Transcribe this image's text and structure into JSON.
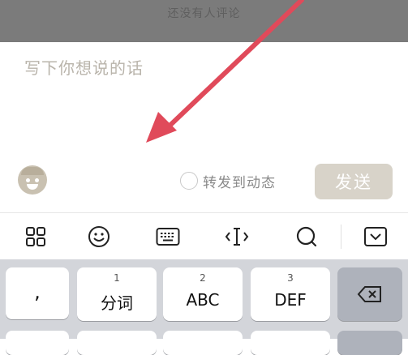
{
  "header": {
    "no_comments_text": "还没有人评论"
  },
  "compose": {
    "placeholder": "写下你想说的话",
    "emoji_icon": "emoji-face-icon",
    "repost_label": "转发到动态",
    "send_label": "发送"
  },
  "toolbar": {
    "icons": [
      "grid-icon",
      "emoji-icon",
      "keyboard-icon",
      "cursor-icon",
      "search-icon",
      "collapse-keyboard-icon"
    ]
  },
  "keyboard": {
    "punct_key": ",",
    "keys": [
      {
        "num": "1",
        "label": "分词"
      },
      {
        "num": "2",
        "label": "ABC"
      },
      {
        "num": "3",
        "label": "DEF"
      }
    ],
    "backspace_icon": "backspace-icon"
  },
  "colors": {
    "arrow": "#e04a5a",
    "send_bg": "#d8d3c9",
    "overlay": "#7b7b7b",
    "keyboard_bg": "#d3d5da"
  }
}
